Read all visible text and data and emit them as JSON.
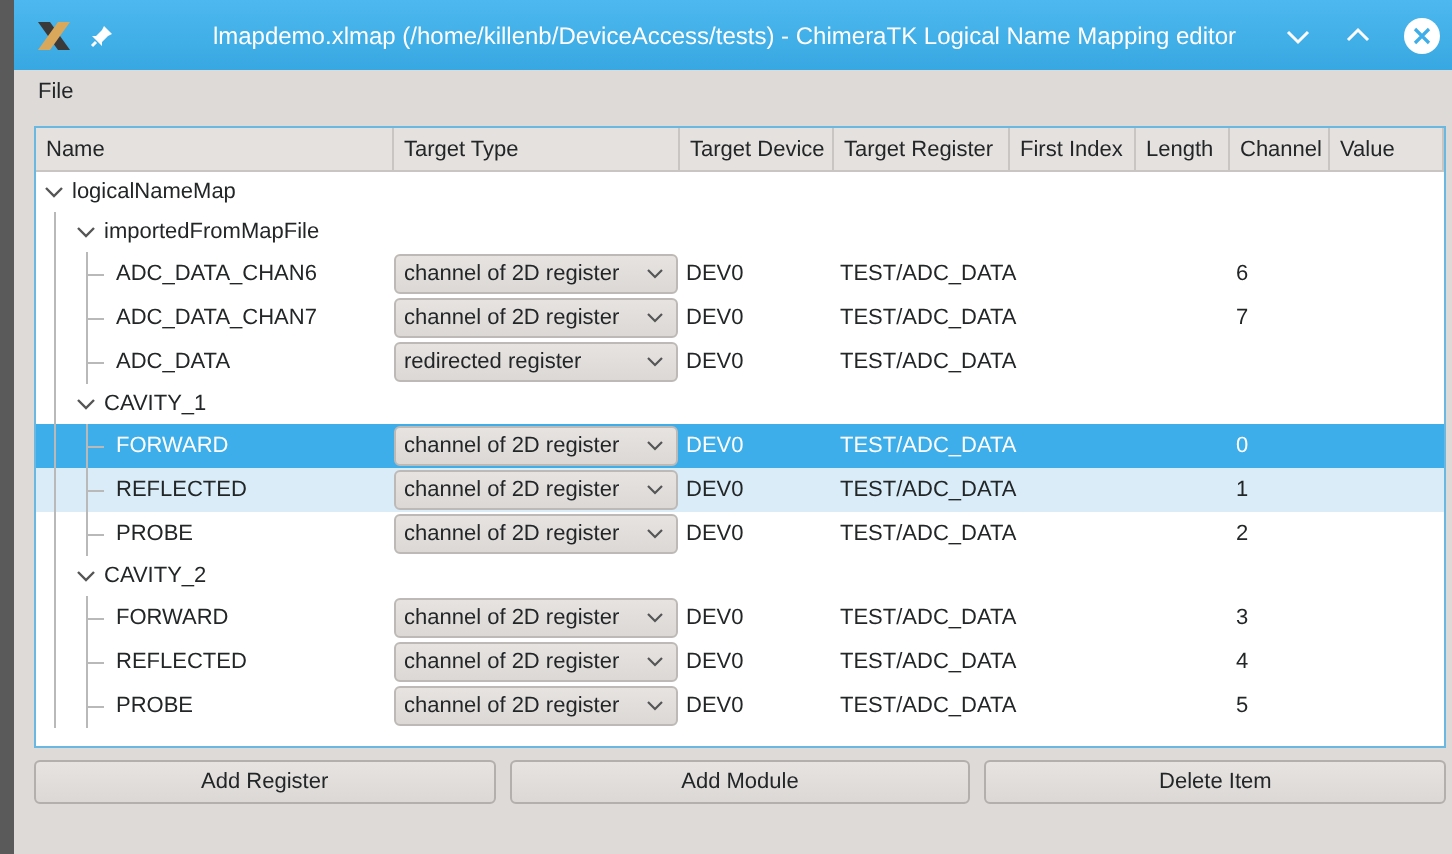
{
  "window": {
    "title": "lmapdemo.xlmap (/home/killenb/DeviceAccess/tests) - ChimeraTK Logical Name Mapping editor"
  },
  "menu": [
    "File"
  ],
  "table": {
    "columns": [
      "Name",
      "Target Type",
      "Target Device",
      "Target Register",
      "First Index",
      "Length",
      "Channel",
      "Value"
    ],
    "tree": [
      {
        "name": "logicalNameMap",
        "selected": false,
        "expanded": true,
        "children": [
          {
            "name": "importedFromMapFile",
            "selected": false,
            "expanded": true,
            "children": [
              {
                "name": "ADC_DATA_CHAN6",
                "selected": false,
                "hovered": false,
                "target_type": "channel of 2D register",
                "target_device": "DEV0",
                "target_register": "TEST/ADC_DATA",
                "channel": "6"
              },
              {
                "name": "ADC_DATA_CHAN7",
                "selected": false,
                "hovered": false,
                "target_type": "channel of 2D register",
                "target_device": "DEV0",
                "target_register": "TEST/ADC_DATA",
                "channel": "7"
              },
              {
                "name": "ADC_DATA",
                "selected": false,
                "hovered": false,
                "target_type": "redirected register",
                "target_device": "DEV0",
                "target_register": "TEST/ADC_DATA"
              }
            ]
          },
          {
            "name": "CAVITY_1",
            "selected": false,
            "expanded": true,
            "children": [
              {
                "name": "FORWARD",
                "selected": true,
                "hovered": false,
                "target_type": "channel of 2D register",
                "target_device": "DEV0",
                "target_register": "TEST/ADC_DATA",
                "channel": "0"
              },
              {
                "name": "REFLECTED",
                "selected": false,
                "hovered": true,
                "target_type": "channel of 2D register",
                "target_device": "DEV0",
                "target_register": "TEST/ADC_DATA",
                "channel": "1"
              },
              {
                "name": "PROBE",
                "selected": false,
                "hovered": false,
                "target_type": "channel of 2D register",
                "target_device": "DEV0",
                "target_register": "TEST/ADC_DATA",
                "channel": "2"
              }
            ]
          },
          {
            "name": "CAVITY_2",
            "selected": false,
            "expanded": true,
            "children": [
              {
                "name": "FORWARD",
                "selected": false,
                "hovered": false,
                "target_type": "channel of 2D register",
                "target_device": "DEV0",
                "target_register": "TEST/ADC_DATA",
                "channel": "3"
              },
              {
                "name": "REFLECTED",
                "selected": false,
                "hovered": false,
                "target_type": "channel of 2D register",
                "target_device": "DEV0",
                "target_register": "TEST/ADC_DATA",
                "channel": "4"
              },
              {
                "name": "PROBE",
                "selected": false,
                "hovered": false,
                "target_type": "channel of 2D register",
                "target_device": "DEV0",
                "target_register": "TEST/ADC_DATA",
                "channel": "5"
              }
            ]
          }
        ]
      }
    ]
  },
  "buttons": [
    "Add Register",
    "Add Module",
    "Delete Item"
  ]
}
